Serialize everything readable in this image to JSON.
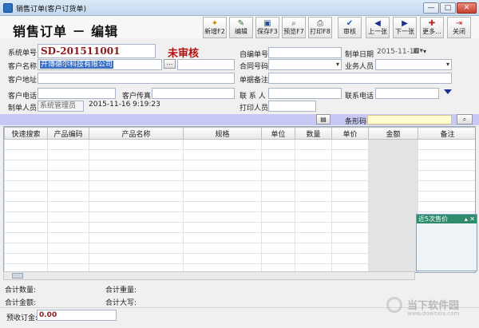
{
  "window": {
    "title": "销售订单(客户订货单)",
    "controls": [
      "—",
      "□",
      "✕"
    ]
  },
  "page_title": "销售订单 － 编辑",
  "toolbar": [
    {
      "label": "新增F2",
      "icon": "new-doc-icon",
      "glyph": "✦"
    },
    {
      "label": "编辑",
      "icon": "edit-icon",
      "glyph": "✎"
    },
    {
      "label": "保存F3",
      "icon": "save-icon",
      "glyph": "▣"
    },
    {
      "label": "预览F7",
      "icon": "preview-icon",
      "glyph": "⌕"
    },
    {
      "label": "打印F8",
      "icon": "print-icon",
      "glyph": "⎙"
    },
    {
      "label": "审核",
      "icon": "check-icon",
      "glyph": "✔"
    },
    {
      "label": "上一张",
      "icon": "prev-icon",
      "glyph": "◀"
    },
    {
      "label": "下一张",
      "icon": "next-icon",
      "glyph": "▶"
    },
    {
      "label": "更多...",
      "icon": "more-icon",
      "glyph": "✚"
    },
    {
      "label": "关闭",
      "icon": "close-icon",
      "glyph": "⇥"
    }
  ],
  "form": {
    "system_no_label": "系统单号",
    "system_no": "SD-201511001",
    "status": "未审核",
    "custom_no_label": "自编单号",
    "custom_no": "",
    "date_label": "制单日期",
    "date": "2015-11-16",
    "customer_label": "客户名称",
    "customer": "开博德尔科技有限公司",
    "browse_label": "...",
    "contract_label": "合同号码",
    "contract": "",
    "salesperson_label": "业务人员",
    "salesperson": "",
    "address_label": "客户地址",
    "address": "",
    "remark_label": "单据备注",
    "remark": "",
    "phone_label": "客户电话",
    "phone": "",
    "fax_label": "客户传真",
    "fax": "",
    "contact_label": "联 系 人",
    "contact": "",
    "contact_phone_label": "联系电话",
    "contact_phone": "",
    "creator_label": "制单人员",
    "creator": "系统管理员",
    "created_at": "2015-11-16 9:19:23",
    "printer_label": "打印人员",
    "printer": ""
  },
  "barcode": {
    "label": "条形码",
    "value": ""
  },
  "grid": {
    "columns": [
      "快速搜索",
      "产品编码",
      "产品名称",
      "规格",
      "单位",
      "数量",
      "单价",
      "金额",
      "备注"
    ],
    "empty_rows": 13
  },
  "side_panel": {
    "title": "近5次售价",
    "controls": "▴ ✕"
  },
  "summary": {
    "total_qty_label": "合计数量:",
    "total_weight_label": "合计重量:",
    "total_amount_label": "合计金额:",
    "total_capital_label": "合计大写:"
  },
  "footer": {
    "prepay_label": "预收订金:",
    "prepay_value": "0.00"
  },
  "watermark": {
    "text": "当下软件园",
    "sub": "www.downxia.com"
  }
}
